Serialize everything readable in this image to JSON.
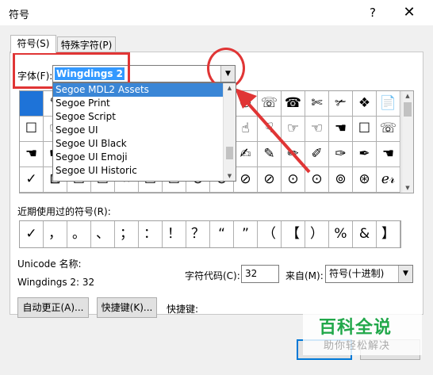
{
  "window": {
    "title": "符号",
    "help_glyph": "?",
    "close_glyph": "✕"
  },
  "tabs": [
    {
      "label": "符号(S)"
    },
    {
      "label": "特殊字符(P)"
    }
  ],
  "font": {
    "label": "字体(F):",
    "value": "Wingdings 2"
  },
  "font_dropdown": {
    "items": [
      "Segoe MDL2 Assets",
      "Segoe Print",
      "Segoe Script",
      "Segoe UI",
      "Segoe UI Black",
      "Segoe UI Emoji",
      "Segoe UI Historic"
    ],
    "highlighted_index": 0
  },
  "symbol_grid": {
    "rows": [
      [
        "",
        "✎",
        "✐",
        "✑",
        "✒",
        "✍",
        "✉",
        "✈",
        "✇",
        "✆",
        "☏",
        "☎",
        "✄",
        "✃",
        "❖",
        "📄",
        "☐",
        "❐",
        "📃",
        "📋",
        "📑",
        "📄"
      ],
      [
        "☐",
        "☞",
        "☜",
        "☛",
        "☚",
        "👎",
        "👍",
        "🖐",
        "✌",
        "☝",
        "☟",
        "☞",
        "☜",
        "☚",
        "☐",
        "☏",
        "🖸",
        "🗒",
        "👍",
        "👎",
        "👁",
        "👄"
      ],
      [
        "☚",
        "☛",
        "☜",
        "☝",
        "☞",
        "☟",
        "✋",
        "✊",
        "✌",
        "✍",
        "✎",
        "✏",
        "✐",
        "✑",
        "✒",
        "☚",
        "☘",
        "❦",
        "✋",
        "☄",
        "✋",
        "✕"
      ],
      [
        "✓",
        "⊠",
        "☒",
        "☒",
        "☓",
        "☑",
        "☑",
        "⊗",
        "⊗",
        "⊘",
        "⊘",
        "⊙",
        "⊙",
        "⊚",
        "⊛",
        "ℯ𝓇",
        "&",
        "&",
        "&",
        "?",
        "?",
        "?"
      ]
    ],
    "selected_cell": "0-0"
  },
  "recent": {
    "label": "近期使用过的符号(R):",
    "symbols": [
      "✓",
      "，",
      "。",
      "、",
      "；",
      "：",
      "！",
      "？",
      "“",
      "”",
      "（",
      "【",
      "）",
      "%",
      "&",
      "】"
    ]
  },
  "unicode": {
    "label": "Unicode 名称:",
    "value": "Wingdings 2: 32"
  },
  "char_code": {
    "label": "字符代码(C):",
    "value": "32"
  },
  "from": {
    "label": "来自(M):",
    "value": "符号(十进制)"
  },
  "buttons": {
    "autocorrect": "自动更正(A)...",
    "shortcut_key": "快捷键(K)...",
    "shortcut_label": "快捷键:"
  },
  "watermark": {
    "title": "百科全说",
    "subtitle": "助你轻松解决"
  },
  "colors": {
    "accent": "#3399ff",
    "annotation": "#e03535",
    "watermark": "#21a84a"
  }
}
